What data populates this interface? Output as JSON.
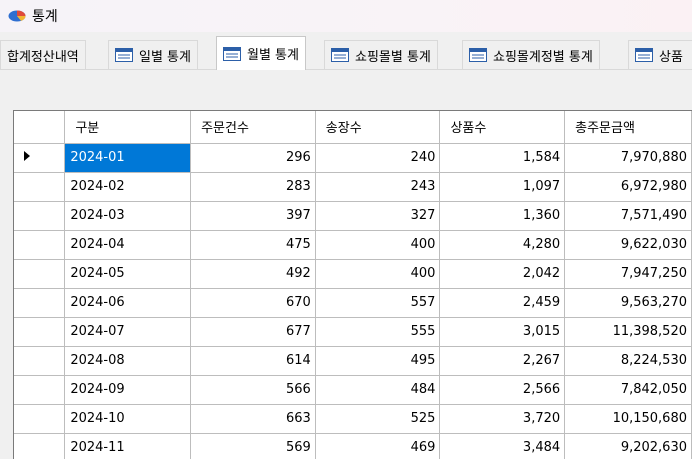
{
  "window": {
    "title": "통계",
    "icon": "pie-chart-icon"
  },
  "tabs": [
    {
      "label": "합계정산내역",
      "icon": "",
      "active": false
    },
    {
      "label": "일별 통계",
      "icon": "grid-form-icon",
      "active": false
    },
    {
      "label": "월별 통계",
      "icon": "grid-form-icon",
      "active": true
    },
    {
      "label": "쇼핑몰별 통계",
      "icon": "grid-form-icon",
      "active": false
    },
    {
      "label": "쇼핑몰계정별 통계",
      "icon": "grid-form-icon",
      "active": false
    },
    {
      "label": "상품",
      "icon": "grid-form-icon",
      "active": false
    }
  ],
  "grid": {
    "columns": [
      "구분",
      "주문건수",
      "송장수",
      "상품수",
      "총주문금액"
    ],
    "current_row_marker": "row-indicator-arrow-icon",
    "selection_color": "#0078d7",
    "rows": [
      [
        "2024-01",
        "296",
        "240",
        "1,584",
        "7,970,880"
      ],
      [
        "2024-02",
        "283",
        "243",
        "1,097",
        "6,972,980"
      ],
      [
        "2024-03",
        "397",
        "327",
        "1,360",
        "7,571,490"
      ],
      [
        "2024-04",
        "475",
        "400",
        "4,280",
        "9,622,030"
      ],
      [
        "2024-05",
        "492",
        "400",
        "2,042",
        "7,947,250"
      ],
      [
        "2024-06",
        "670",
        "557",
        "2,459",
        "9,563,270"
      ],
      [
        "2024-07",
        "677",
        "555",
        "3,015",
        "11,398,520"
      ],
      [
        "2024-08",
        "614",
        "495",
        "2,267",
        "8,224,530"
      ],
      [
        "2024-09",
        "566",
        "484",
        "2,566",
        "7,842,050"
      ],
      [
        "2024-10",
        "663",
        "525",
        "3,720",
        "10,150,680"
      ],
      [
        "2024-11",
        "569",
        "469",
        "3,484",
        "9,202,630"
      ]
    ]
  }
}
